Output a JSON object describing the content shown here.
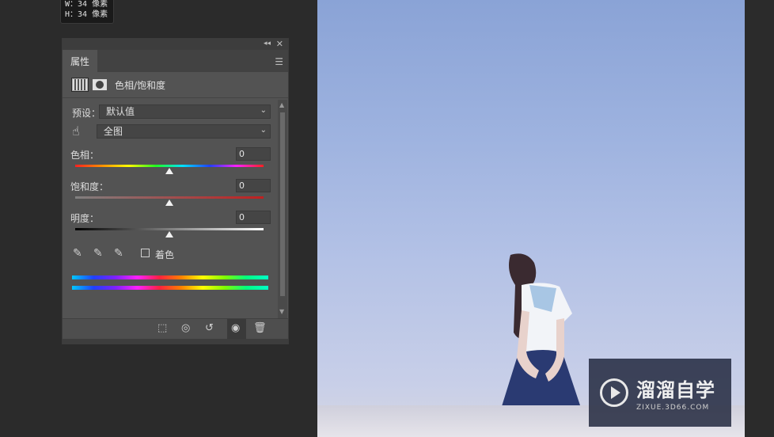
{
  "tooltip": {
    "w": "W：34 像素",
    "h": "H：34 像素"
  },
  "panel": {
    "collapse_icon": "double-chevron-left-icon",
    "close_icon": "close-icon",
    "tab_label": "属性",
    "menu_icon": "panel-menu-icon",
    "adjustment_title": "色相/饱和度",
    "preset_label": "预设：",
    "preset_value": "默认值",
    "range_value": "全图",
    "hue": {
      "label": "色相：",
      "value": "0"
    },
    "saturation": {
      "label": "饱和度：",
      "value": "0"
    },
    "lightness": {
      "label": "明度：",
      "value": "0"
    },
    "colorize_label": "着色",
    "colorize_checked": false
  },
  "watermark": {
    "name": "溜溜自学",
    "url": "ZIXUE.3D66.COM"
  },
  "colors": {
    "panel_bg": "#535353",
    "workspace_bg": "#2b2b2b"
  }
}
